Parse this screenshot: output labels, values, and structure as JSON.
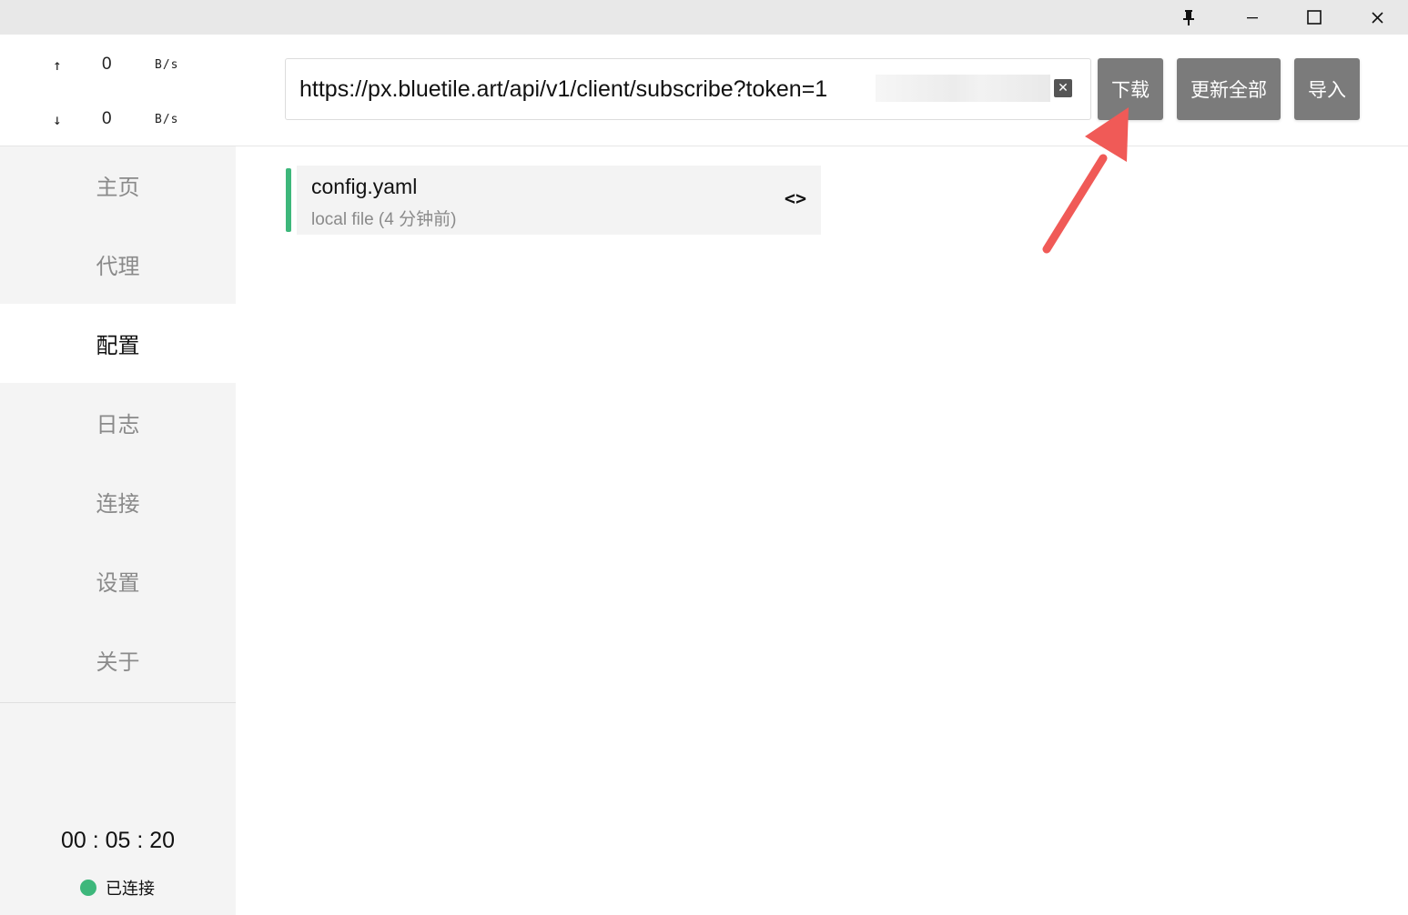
{
  "titlebar": {
    "pin_icon": "pin-icon",
    "minimize_glyph": "—",
    "maximize_glyph": "☐",
    "close_glyph": "✕"
  },
  "speed": {
    "upload": {
      "arrow": "↑",
      "value": "0",
      "unit": "B/s"
    },
    "download": {
      "arrow": "↓",
      "value": "0",
      "unit": "B/s"
    }
  },
  "nav": {
    "items": [
      {
        "label": "主页"
      },
      {
        "label": "代理"
      },
      {
        "label": "配置"
      },
      {
        "label": "日志"
      },
      {
        "label": "连接"
      },
      {
        "label": "设置"
      },
      {
        "label": "关于"
      }
    ],
    "active": "配置"
  },
  "footer": {
    "uptime": "00 : 05 : 20",
    "status": "已连接",
    "status_color": "#3db77b"
  },
  "header": {
    "url_value": "https://px.bluetile.art/api/v1/client/subscribe?token=1",
    "clear_glyph": "✕",
    "buttons": {
      "download": "下载",
      "update_all": "更新全部",
      "import": "导入"
    },
    "button_color": "#7b7b7b"
  },
  "profiles": [
    {
      "name": "config.yaml",
      "subtitle": "local file (4 分钟前)",
      "edit_glyph": "<>",
      "accent": "#3db77b"
    }
  ],
  "annotation_color": "#f05a57"
}
